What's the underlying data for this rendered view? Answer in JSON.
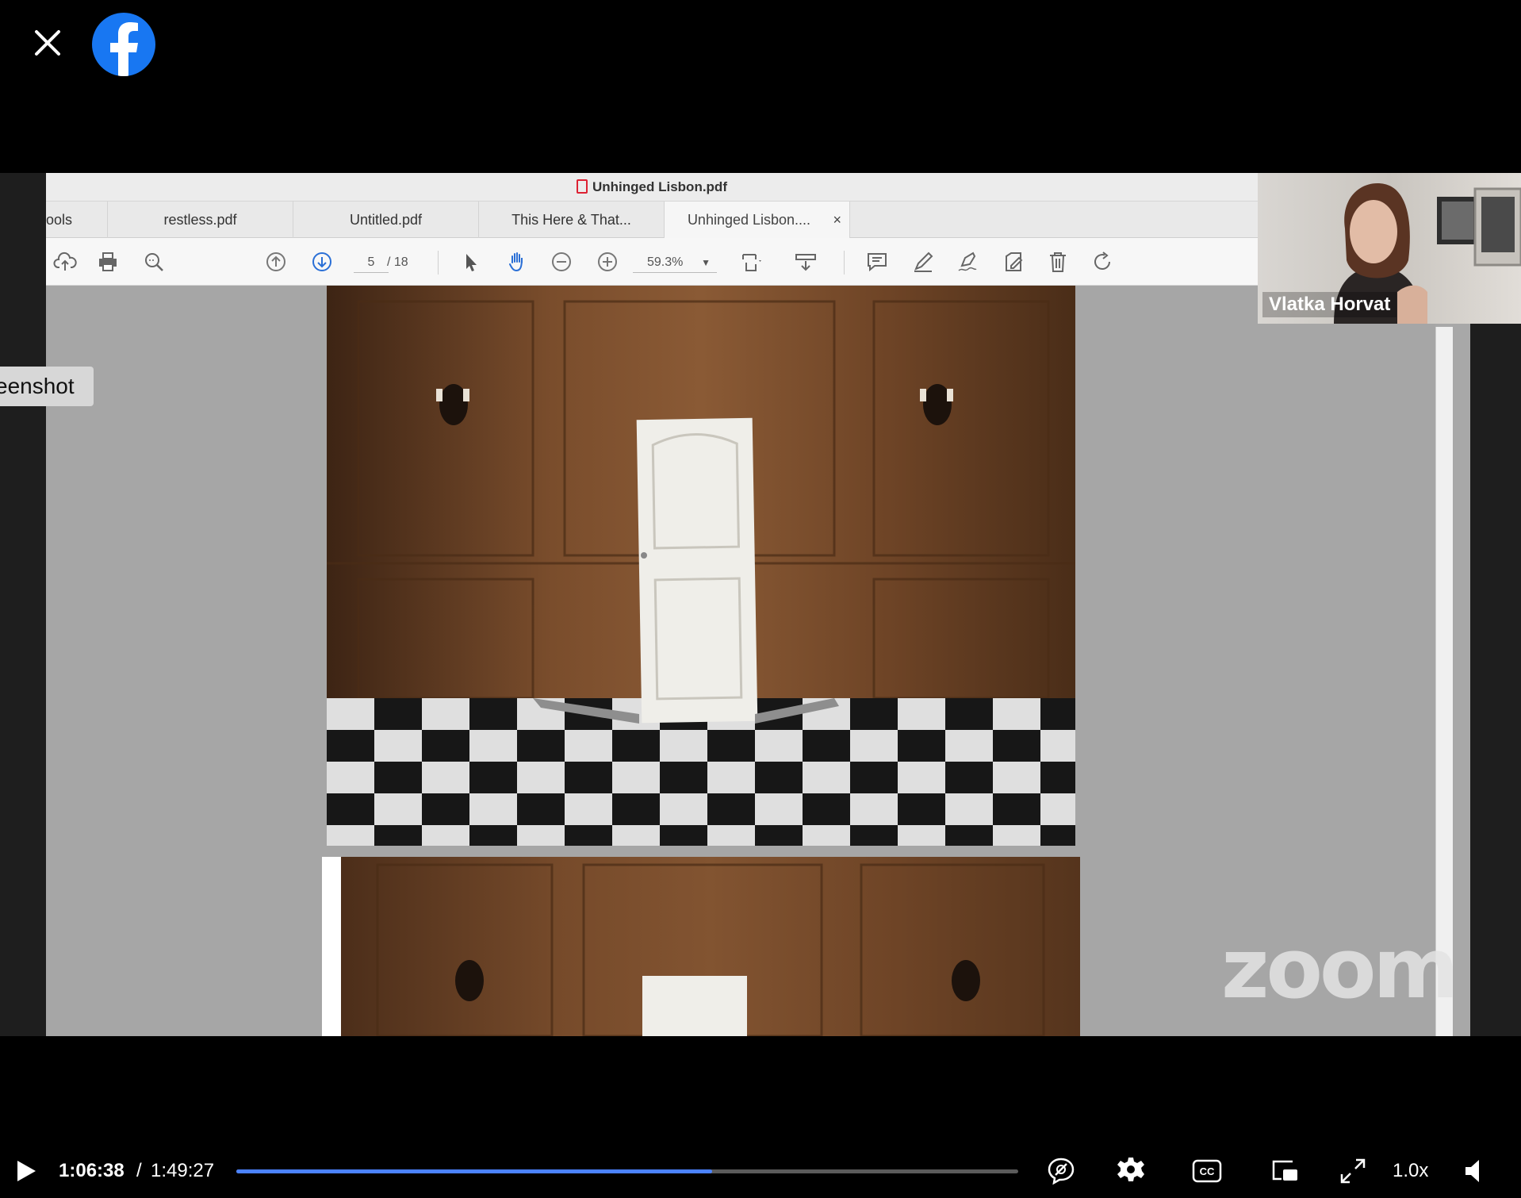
{
  "top": {
    "close_icon": "close-icon",
    "logo": "facebook-logo"
  },
  "pdf": {
    "window_title": "Unhinged Lisbon.pdf",
    "tabs": [
      {
        "label": "ools"
      },
      {
        "label": "restless.pdf"
      },
      {
        "label": "Untitled.pdf"
      },
      {
        "label": "This Here & That..."
      },
      {
        "label": "Unhinged Lisbon....",
        "close": "×"
      }
    ],
    "page_current": "5",
    "page_total": "/ 18",
    "zoom": "59.3%"
  },
  "overlay": {
    "screenshot_tooltip": "eenshot"
  },
  "participant": {
    "name": "Vlatka Horvat"
  },
  "watermark": "zoom",
  "player": {
    "time_current": "1:06:38",
    "time_separator": "/",
    "time_total": "1:49:27",
    "progress_fraction": 0.609,
    "speed": "1.0x",
    "accent": "#4b82ff"
  }
}
